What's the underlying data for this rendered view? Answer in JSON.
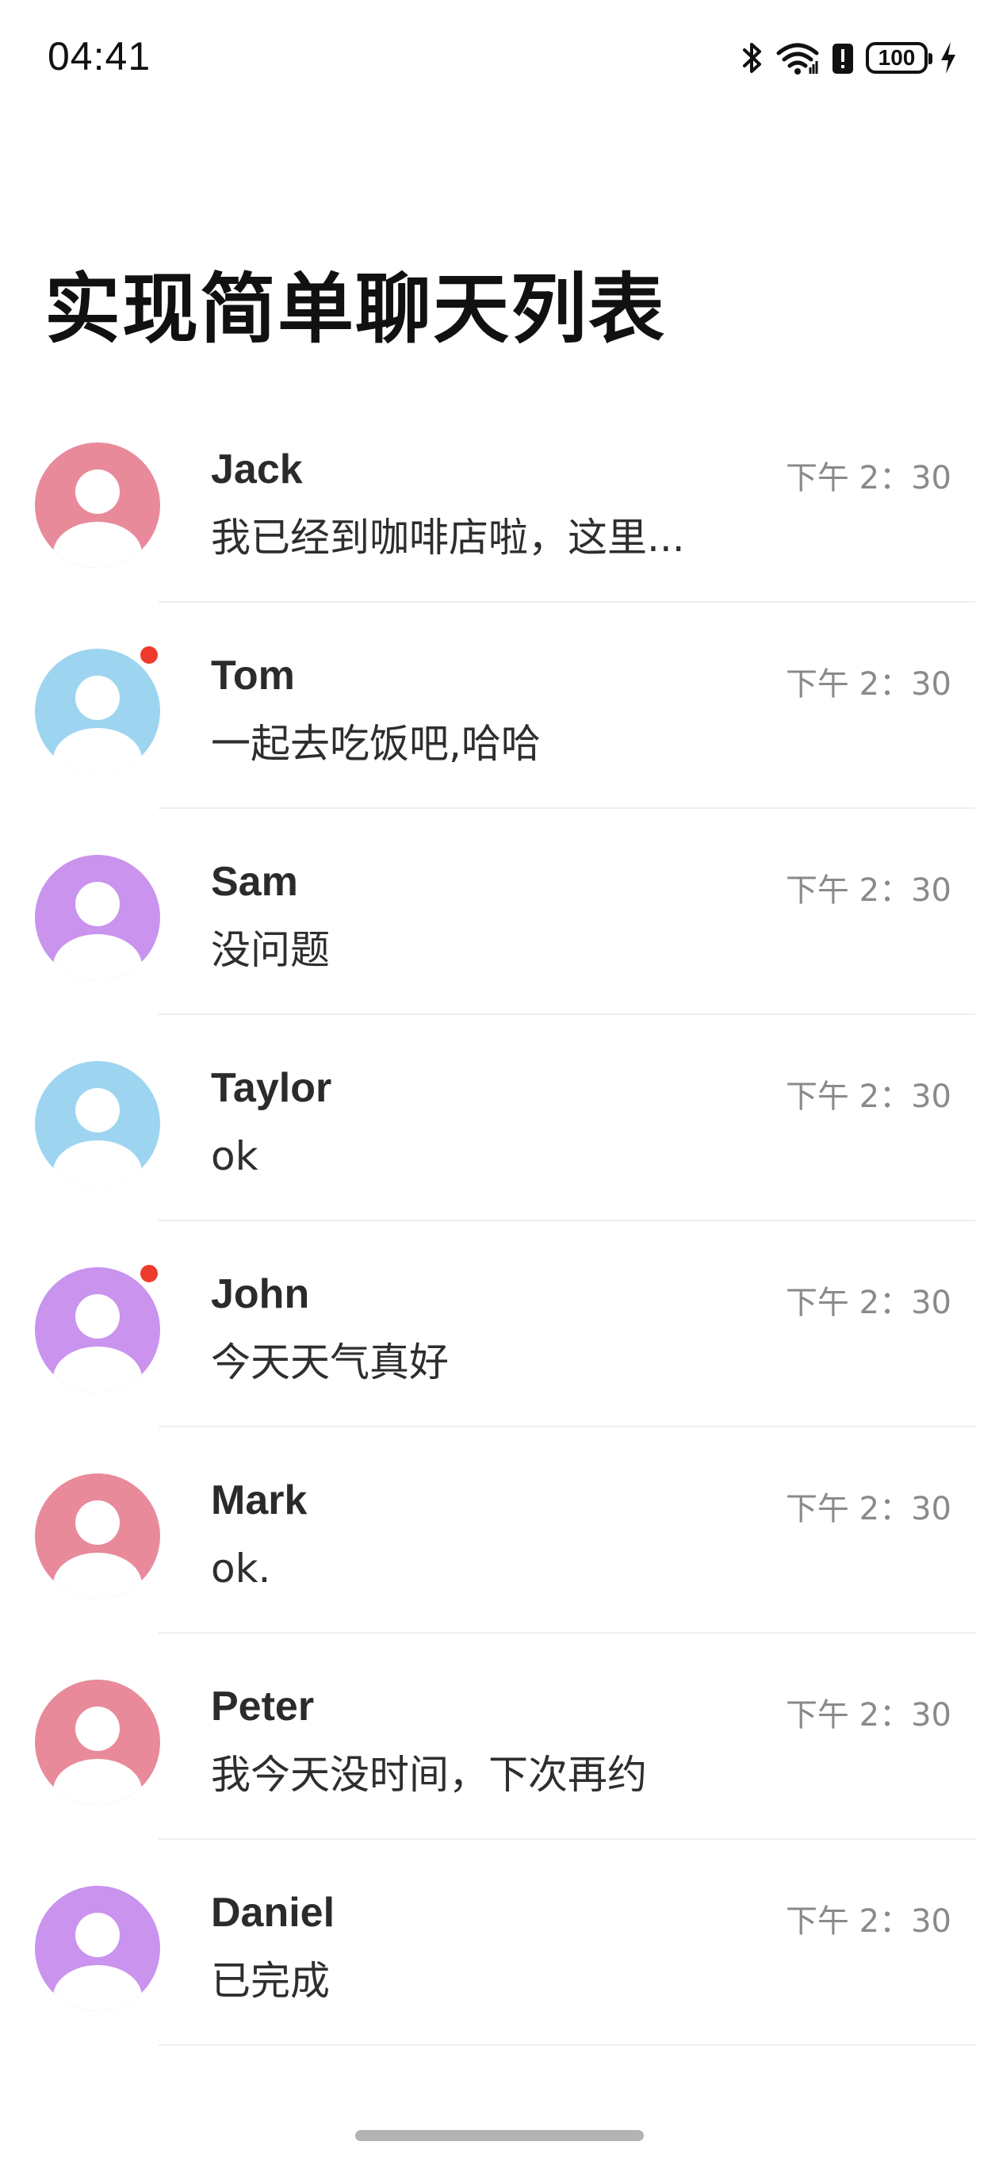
{
  "status_bar": {
    "time": "04:41",
    "battery": "100",
    "icons": [
      "bluetooth-icon",
      "wifi-icon",
      "battery-alert-icon",
      "battery-icon",
      "charging-icon"
    ]
  },
  "page": {
    "title": "实现简单聊天列表"
  },
  "chats": [
    {
      "name": "Jack",
      "message": "我已经到咖啡店啦，这里...",
      "time": "下午 2：30",
      "avatar_color": "#e88a9a",
      "unread": false
    },
    {
      "name": "Tom",
      "message": "一起去吃饭吧,哈哈",
      "time": "下午 2：30",
      "avatar_color": "#9dd5f0",
      "unread": true
    },
    {
      "name": "Sam",
      "message": "没问题",
      "time": "下午 2：30",
      "avatar_color": "#c993ee",
      "unread": false
    },
    {
      "name": "Taylor",
      "message": "ok",
      "time": "下午 2：30",
      "avatar_color": "#9dd5f0",
      "unread": false
    },
    {
      "name": "John",
      "message": "今天天气真好",
      "time": "下午 2：30",
      "avatar_color": "#c993ee",
      "unread": true
    },
    {
      "name": "Mark",
      "message": "ok.",
      "time": "下午 2：30",
      "avatar_color": "#e88a9a",
      "unread": false
    },
    {
      "name": "Peter",
      "message": "我今天没时间，下次再约",
      "time": "下午 2：30",
      "avatar_color": "#e88a9a",
      "unread": false
    },
    {
      "name": "Daniel",
      "message": "已完成",
      "time": "下午 2：30",
      "avatar_color": "#c993ee",
      "unread": false
    }
  ],
  "colors": {
    "unread_dot": "#ef3b2c",
    "divider": "#eeeeee",
    "time_text": "#8a8a8a"
  }
}
